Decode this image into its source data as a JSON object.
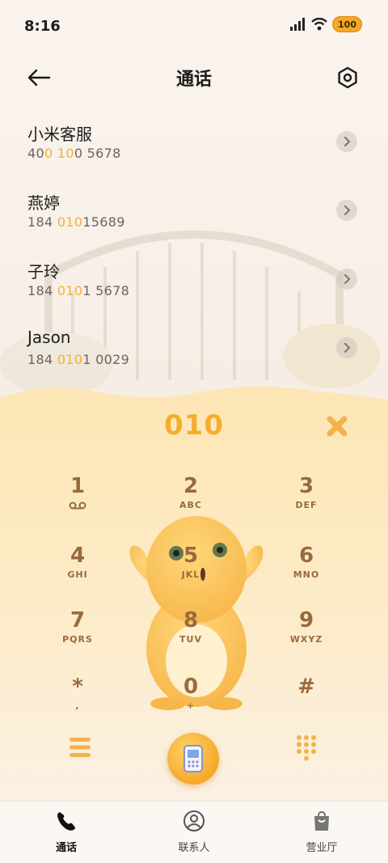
{
  "status": {
    "time": "8:16",
    "battery": "100"
  },
  "header": {
    "title": "通话"
  },
  "results": [
    {
      "name": "小米客服",
      "number_parts": [
        "40",
        "0",
        " ",
        "10",
        "0 5678"
      ]
    },
    {
      "name": "燕婷",
      "number_parts": [
        "184 ",
        "010",
        "",
        "",
        "15689"
      ]
    },
    {
      "name": "子玲",
      "number_parts": [
        "184 ",
        "010",
        "",
        "",
        "1 5678"
      ]
    },
    {
      "name": "Jason",
      "number_parts": [
        "184 ",
        "010",
        "",
        "",
        "1 0029"
      ]
    }
  ],
  "dialer": {
    "input": "010",
    "keys": [
      {
        "digit": "1",
        "letters": ""
      },
      {
        "digit": "2",
        "letters": "ABC"
      },
      {
        "digit": "3",
        "letters": "DEF"
      },
      {
        "digit": "4",
        "letters": "GHI"
      },
      {
        "digit": "5",
        "letters": "JKL"
      },
      {
        "digit": "6",
        "letters": "MNO"
      },
      {
        "digit": "7",
        "letters": "PQRS"
      },
      {
        "digit": "8",
        "letters": "TUV"
      },
      {
        "digit": "9",
        "letters": "WXYZ"
      },
      {
        "digit": "*",
        "letters": ","
      },
      {
        "digit": "0",
        "letters": "+"
      },
      {
        "digit": "#",
        "letters": ""
      }
    ]
  },
  "bottom_nav": [
    {
      "label": "通话",
      "icon": "phone-icon",
      "active": true
    },
    {
      "label": "联系人",
      "icon": "person-icon",
      "active": false
    },
    {
      "label": "营业厅",
      "icon": "bag-icon",
      "active": false
    }
  ],
  "colors": {
    "accent": "#f4ae2c",
    "key_text": "#9a6a3e",
    "panel": "#fde7b8"
  }
}
